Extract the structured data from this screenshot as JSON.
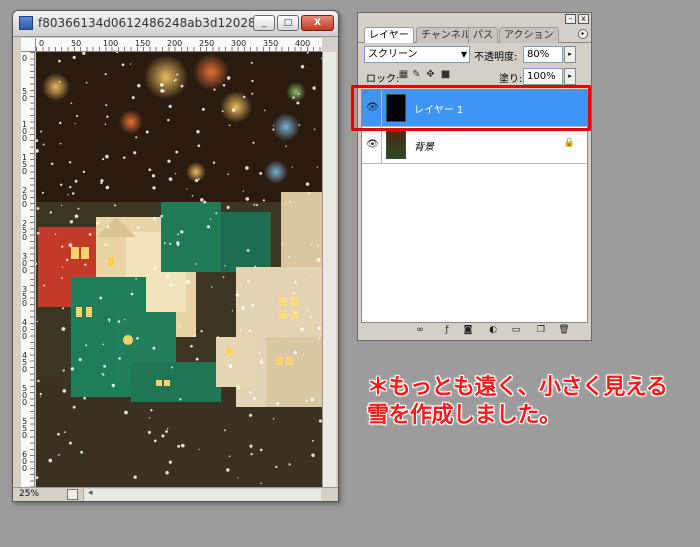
{
  "document_window": {
    "title": "f80366134d0612486248ab3d12028...",
    "minimize_label": "_",
    "maximize_label": "□",
    "close_label": "X",
    "ruler_top_ticks": [
      "0",
      "50",
      "100",
      "150",
      "200",
      "250",
      "300",
      "350",
      "400"
    ],
    "ruler_left_ticks": [
      "0",
      "50",
      "100",
      "150",
      "200",
      "250",
      "300",
      "350",
      "400",
      "450",
      "500",
      "550",
      "600"
    ],
    "zoom": "25%"
  },
  "layers_panel": {
    "tabs": [
      "レイヤー",
      "チャンネル",
      "パス",
      "アクション"
    ],
    "active_tab": "レイヤー",
    "blend_mode": "スクリーン",
    "opacity_label": "不透明度:",
    "opacity_value": "80%",
    "lock_label": "ロック:",
    "fill_label": "塗り:",
    "fill_value": "100%",
    "layers": [
      {
        "name": "レイヤー 1",
        "selected": true,
        "visible": true,
        "locked": false
      },
      {
        "name": "背景",
        "selected": false,
        "visible": true,
        "locked": true
      }
    ]
  },
  "caption": {
    "line1": "＊もっとも遠く、小さく見える",
    "line2": "雪を作成しました。"
  },
  "colors": {
    "background": "#9c9c9c",
    "selection": "#3d95f5",
    "highlight": "#e60000",
    "caption": "#ff1a1a"
  }
}
